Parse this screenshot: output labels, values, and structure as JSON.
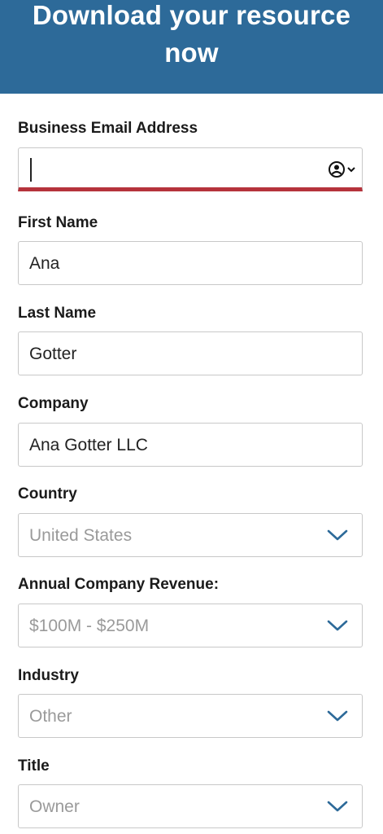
{
  "header": {
    "title_line1": "Download your resource",
    "title_line2": "now",
    "background_color": "#2d6a99"
  },
  "form": {
    "email": {
      "label": "Business Email Address",
      "value": "",
      "error_color": "#b5333c"
    },
    "first_name": {
      "label": "First Name",
      "value": "Ana"
    },
    "last_name": {
      "label": "Last Name",
      "value": "Gotter"
    },
    "company": {
      "label": "Company",
      "value": "Ana Gotter LLC"
    },
    "country": {
      "label": "Country",
      "selected": "United States"
    },
    "revenue": {
      "label": "Annual Company Revenue:",
      "selected": "$100M - $250M"
    },
    "industry": {
      "label": "Industry",
      "selected": "Other"
    },
    "title": {
      "label": "Title",
      "selected": "Owner"
    }
  },
  "icons": {
    "autofill": "contact-autofill-icon",
    "dropdown": "chevron-down-icon"
  }
}
